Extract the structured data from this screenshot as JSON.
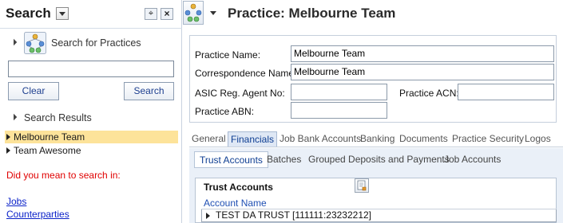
{
  "search_pane": {
    "title": "Search",
    "pin_symbol": "⌖",
    "close_symbol": "×",
    "search_for_label": "Search for Practices",
    "search_input_value": "",
    "clear_label": "Clear",
    "search_label": "Search",
    "results_heading": "Search Results",
    "results": [
      "Melbourne Team",
      "Team Awesome"
    ],
    "selected_result_index": 0,
    "did_you_mean": "Did you mean to search in:",
    "links": [
      "Jobs",
      "Counterparties"
    ]
  },
  "detail": {
    "title": "Practice: Melbourne Team",
    "fields": {
      "practice_name_label": "Practice Name:",
      "practice_name_value": "Melbourne Team",
      "correspondence_name_label": "Correspondence Name:",
      "correspondence_name_value": "Melbourne Team",
      "asic_label": "ASIC Reg. Agent No:",
      "asic_value": "",
      "acn_label": "Practice ACN:",
      "acn_value": "",
      "abn_label": "Practice ABN:",
      "abn_value": ""
    },
    "tabs": [
      "General",
      "Financials",
      "Job Bank Accounts",
      "Banking",
      "Documents",
      "Practice Security",
      "Logos"
    ],
    "active_tab": "Financials",
    "subtabs": [
      "Trust Accounts",
      "Batches",
      "Grouped Deposits and Payments",
      "Job Accounts"
    ],
    "active_subtab": "Trust Accounts",
    "grid": {
      "title": "Trust Accounts",
      "column": "Account Name",
      "rows": [
        "TEST DA TRUST  [111111:23232212]"
      ]
    }
  },
  "colors": {
    "selection": "#fde39a",
    "link": "#0b22c9",
    "warning_text": "#e00000",
    "tab_active": "#0e3e92",
    "panel_bg": "#eaf0f8"
  },
  "icons": {
    "practice": "practice-network-icon",
    "pin": "pin-icon",
    "close": "close-icon",
    "grid_action": "export-icon"
  }
}
